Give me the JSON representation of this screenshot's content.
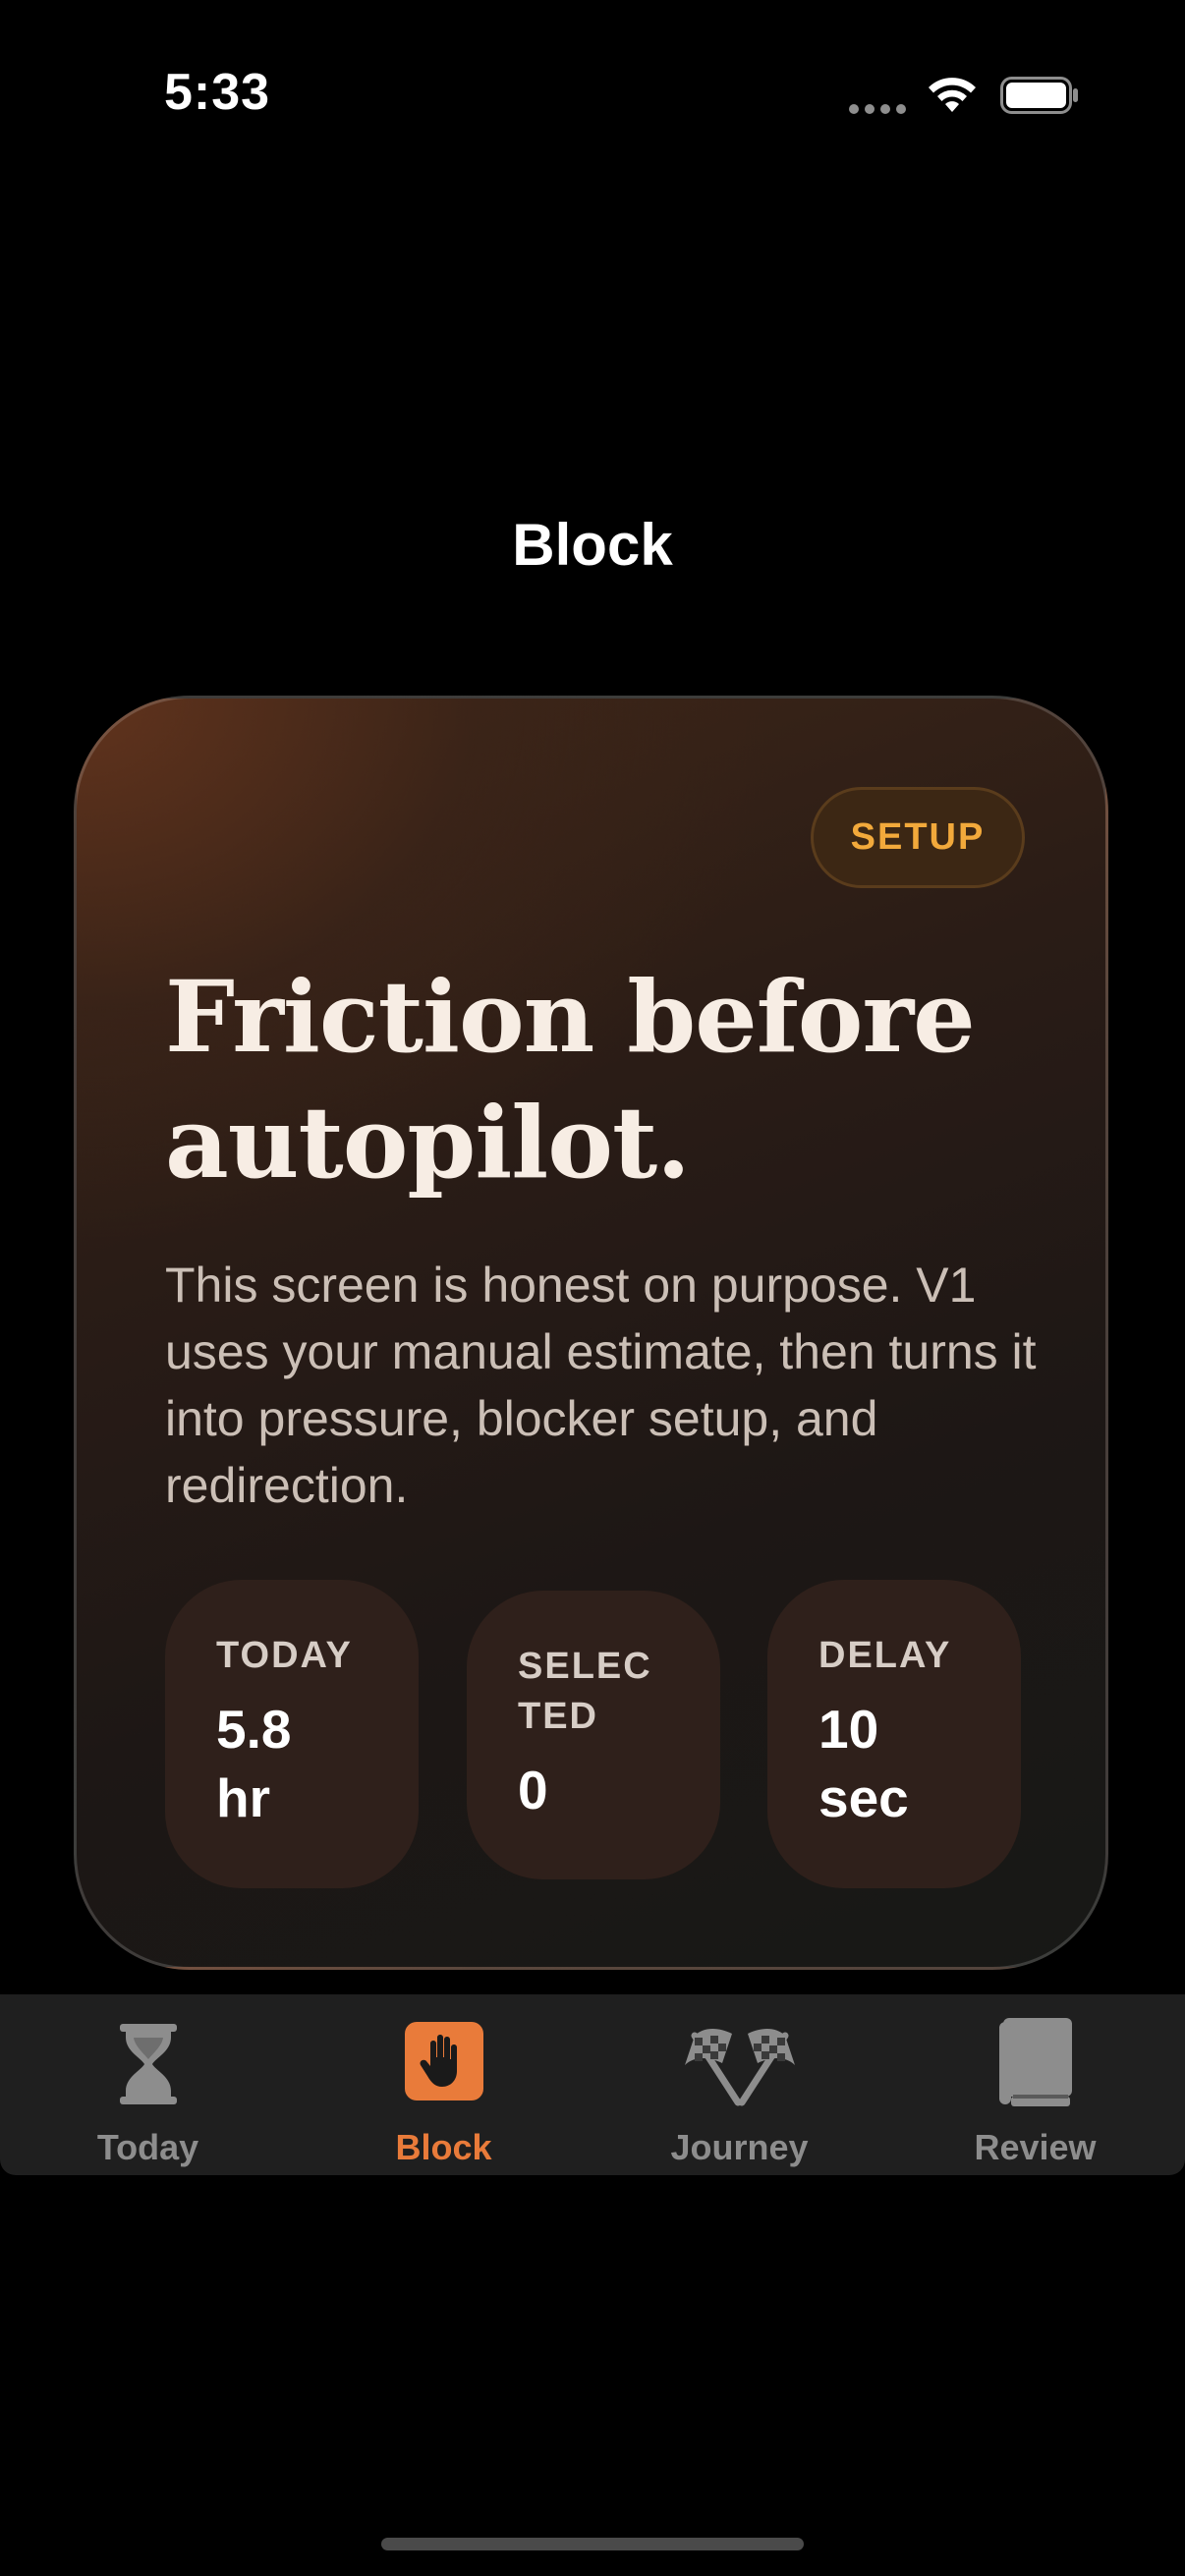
{
  "status_bar": {
    "time": "5:33"
  },
  "nav": {
    "title": "Block"
  },
  "card": {
    "badge": "SETUP",
    "heading_line1": "Friction before",
    "heading_line2": "autopilot.",
    "body": "This screen is honest on purpose. V1 uses your manual estimate, then turns it into pressure, blocker setup, and redirection.",
    "stats": [
      {
        "label_line1": "TODAY",
        "label_line2": "",
        "value_line1": "5.8",
        "value_line2": "hr"
      },
      {
        "label_line1": "SELEC",
        "label_line2": "TED",
        "value_line1": "0",
        "value_line2": ""
      },
      {
        "label_line1": "DELAY",
        "label_line2": "",
        "value_line1": "10",
        "value_line2": "sec"
      }
    ]
  },
  "tab_bar": {
    "active_index": 1,
    "tabs": [
      {
        "label": "Today",
        "icon": "hourglass-icon"
      },
      {
        "label": "Block",
        "icon": "hand-raised-icon"
      },
      {
        "label": "Journey",
        "icon": "checkered-flags-icon"
      },
      {
        "label": "Review",
        "icon": "book-icon"
      }
    ]
  },
  "colors": {
    "accent": "#e97b3a",
    "badge_text": "#f2a93b",
    "inactive_tab": "#8d8d8d"
  }
}
